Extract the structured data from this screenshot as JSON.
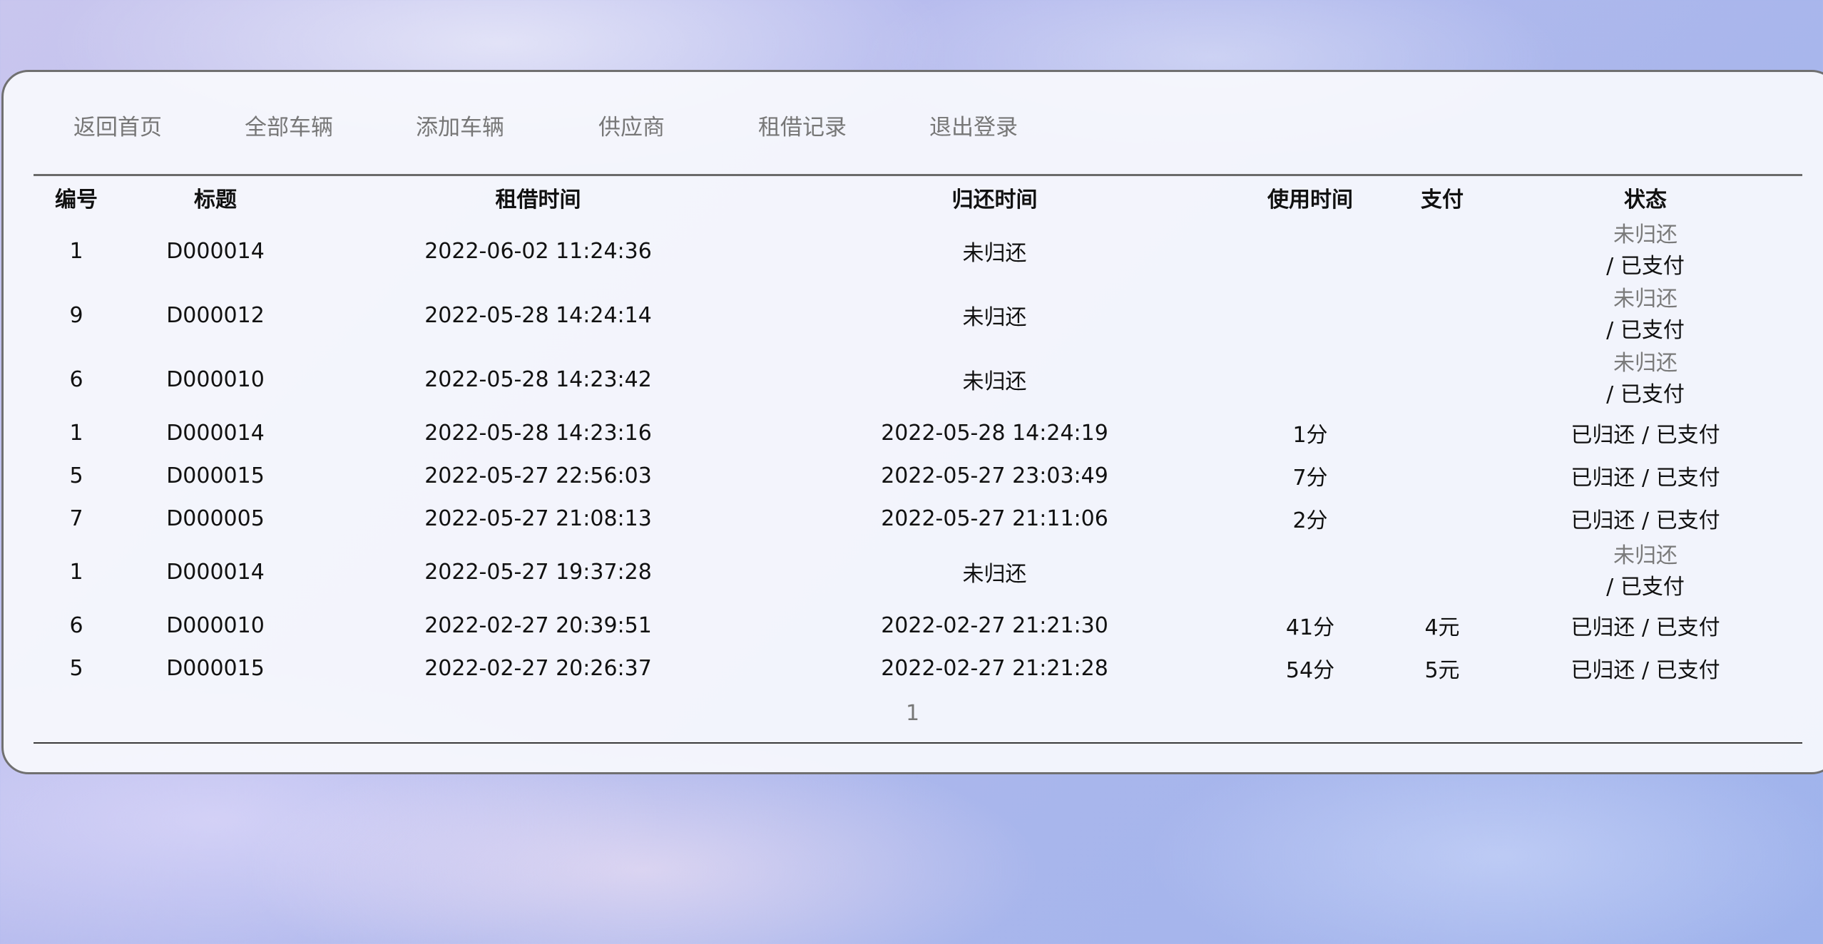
{
  "nav": {
    "items": [
      "返回首页",
      "全部车辆",
      "添加车辆",
      "供应商",
      "租借记录",
      "退出登录"
    ]
  },
  "table": {
    "headers": [
      "编号",
      "标题",
      "租借时间",
      "归还时间",
      "使用时间",
      "支付",
      "状态"
    ],
    "rows": [
      {
        "id": "1",
        "title": "D000014",
        "rent_time": "2022-06-02 11:24:36",
        "return_time": "未归还",
        "use_time": "",
        "payment": "",
        "status_return": "未归还",
        "status_pay": "/ 已支付",
        "returned": false
      },
      {
        "id": "9",
        "title": "D000012",
        "rent_time": "2022-05-28 14:24:14",
        "return_time": "未归还",
        "use_time": "",
        "payment": "",
        "status_return": "未归还",
        "status_pay": "/ 已支付",
        "returned": false
      },
      {
        "id": "6",
        "title": "D000010",
        "rent_time": "2022-05-28 14:23:42",
        "return_time": "未归还",
        "use_time": "",
        "payment": "",
        "status_return": "未归还",
        "status_pay": "/ 已支付",
        "returned": false
      },
      {
        "id": "1",
        "title": "D000014",
        "rent_time": "2022-05-28 14:23:16",
        "return_time": "2022-05-28 14:24:19",
        "use_time": "1分",
        "payment": "",
        "status_return": "已归还",
        "status_pay": "/ 已支付",
        "returned": true
      },
      {
        "id": "5",
        "title": "D000015",
        "rent_time": "2022-05-27 22:56:03",
        "return_time": "2022-05-27 23:03:49",
        "use_time": "7分",
        "payment": "",
        "status_return": "已归还",
        "status_pay": "/ 已支付",
        "returned": true
      },
      {
        "id": "7",
        "title": "D000005",
        "rent_time": "2022-05-27 21:08:13",
        "return_time": "2022-05-27 21:11:06",
        "use_time": "2分",
        "payment": "",
        "status_return": "已归还",
        "status_pay": "/ 已支付",
        "returned": true
      },
      {
        "id": "1",
        "title": "D000014",
        "rent_time": "2022-05-27 19:37:28",
        "return_time": "未归还",
        "use_time": "",
        "payment": "",
        "status_return": "未归还",
        "status_pay": "/ 已支付",
        "returned": false
      },
      {
        "id": "6",
        "title": "D000010",
        "rent_time": "2022-02-27 20:39:51",
        "return_time": "2022-02-27 21:21:30",
        "use_time": "41分",
        "payment": "4元",
        "status_return": "已归还",
        "status_pay": "/ 已支付",
        "returned": true
      },
      {
        "id": "5",
        "title": "D000015",
        "rent_time": "2022-02-27 20:26:37",
        "return_time": "2022-02-27 21:21:28",
        "use_time": "54分",
        "payment": "5元",
        "status_return": "已归还",
        "status_pay": "/ 已支付",
        "returned": true
      }
    ]
  },
  "pagination": {
    "current_page": "1"
  }
}
